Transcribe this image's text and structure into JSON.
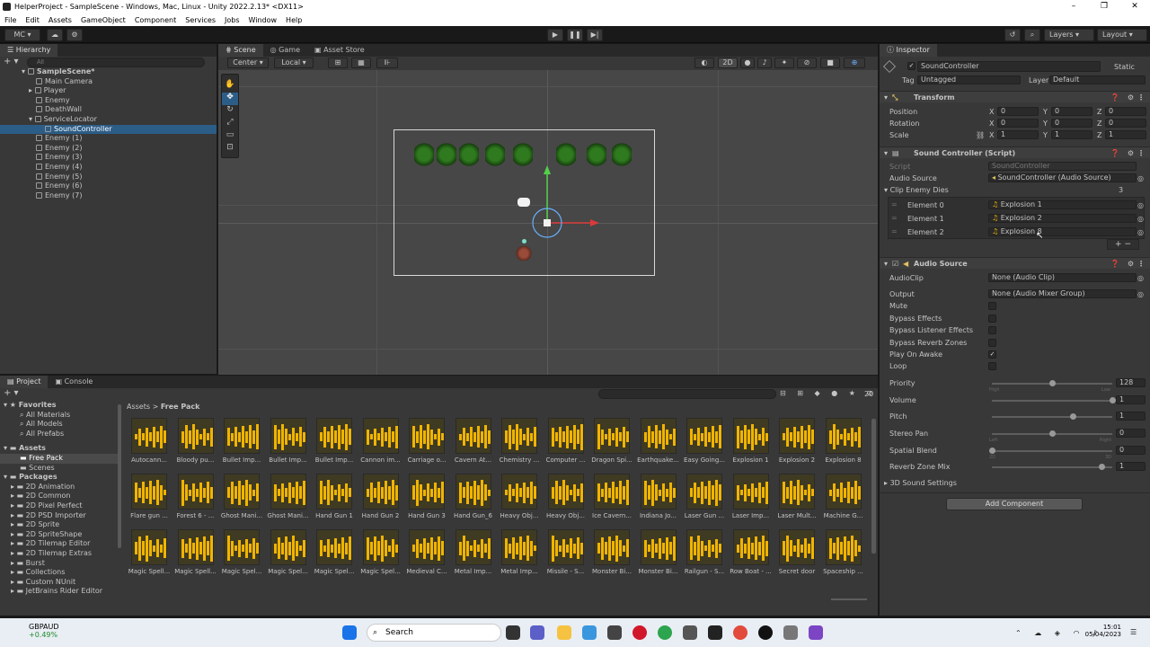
{
  "window": {
    "title": "HelperProject - SampleScene - Windows, Mac, Linux - Unity 2022.2.13* <DX11>"
  },
  "menu": [
    "File",
    "Edit",
    "Assets",
    "GameObject",
    "Component",
    "Services",
    "Jobs",
    "Window",
    "Help"
  ],
  "toolbar": {
    "account": "MC",
    "layers": "Layers",
    "layout": "Layout"
  },
  "hierarchy": {
    "tab": "Hierarchy",
    "search_placeholder": "All",
    "scene": "SampleScene*",
    "items": [
      "Main Camera",
      "Player",
      "Enemy",
      "DeathWall",
      "ServiceLocator",
      "SoundController",
      "Enemy (1)",
      "Enemy (2)",
      "Enemy (3)",
      "Enemy (4)",
      "Enemy (5)",
      "Enemy (6)",
      "Enemy (7)"
    ],
    "selected": "SoundController"
  },
  "scene_tabs": [
    "Scene",
    "Game",
    "Asset Store"
  ],
  "scene_toolbar": {
    "pivot": "Center",
    "space": "Local",
    "mode2d": "2D"
  },
  "inspector": {
    "tab": "Inspector",
    "object_name": "SoundController",
    "static_label": "Static",
    "tag_label": "Tag",
    "tag_value": "Untagged",
    "layer_label": "Layer",
    "layer_value": "Default",
    "transform": {
      "title": "Transform",
      "position_label": "Position",
      "rotation_label": "Rotation",
      "scale_label": "Scale",
      "position": [
        "0",
        "0",
        "0"
      ],
      "rotation": [
        "0",
        "0",
        "0"
      ],
      "scale": [
        "1",
        "1",
        "1"
      ],
      "x": "X",
      "y": "Y",
      "z": "Z"
    },
    "sound_controller": {
      "title": "Sound Controller (Script)",
      "script_label": "Script",
      "script_value": "SoundController",
      "audio_source_label": "Audio Source",
      "audio_source_value": "SoundController (Audio Source)",
      "clip_list_label": "Clip Enemy Dies",
      "clip_count": "3",
      "elements": [
        {
          "label": "Element 0",
          "value": "Explosion 1"
        },
        {
          "label": "Element 1",
          "value": "Explosion 2"
        },
        {
          "label": "Element 2",
          "value": "Explosion 8"
        }
      ],
      "add": "+",
      "remove": "−"
    },
    "audio_source": {
      "title": "Audio Source",
      "audioclip_label": "AudioClip",
      "audioclip_value": "None (Audio Clip)",
      "output_label": "Output",
      "output_value": "None (Audio Mixer Group)",
      "mute": "Mute",
      "bypass_effects": "Bypass Effects",
      "bypass_listener": "Bypass Listener Effects",
      "bypass_reverb": "Bypass Reverb Zones",
      "play_on_awake": "Play On Awake",
      "loop": "Loop",
      "priority_label": "Priority",
      "priority_value": "128",
      "priority_level": 0.5,
      "priority_low": "Low",
      "priority_high": "High",
      "volume_label": "Volume",
      "volume_value": "1",
      "volume_level": 1.0,
      "pitch_label": "Pitch",
      "pitch_value": "1",
      "pitch_level": 0.67,
      "stereo_pan_label": "Stereo Pan",
      "stereo_pan_value": "0",
      "stereo_pan_level": 0.5,
      "pan_left": "Left",
      "pan_right": "Right",
      "spatial_blend_label": "Spatial Blend",
      "spatial_blend_value": "0",
      "spatial_blend_level": 0.0,
      "blend_2d": "2D",
      "blend_3d": "3D",
      "reverb_mix_label": "Reverb Zone Mix",
      "reverb_mix_value": "1",
      "reverb_mix_level": 0.91,
      "sound_settings": "3D Sound Settings"
    },
    "add_component": "Add Component"
  },
  "project": {
    "tabs": [
      "Project",
      "Console"
    ],
    "breadcrumb": [
      "Assets",
      "Free Pack"
    ],
    "badge": "20",
    "favorites_title": "Favorites",
    "favorites": [
      "All Materials",
      "All Models",
      "All Prefabs"
    ],
    "assets_title": "Assets",
    "assets": [
      "Free Pack",
      "Scenes"
    ],
    "packages_title": "Packages",
    "packages": [
      "2D Animation",
      "2D Common",
      "2D Pixel Perfect",
      "2D PSD Importer",
      "2D Sprite",
      "2D SpriteShape",
      "2D Tilemap Editor",
      "2D Tilemap Extras",
      "Burst",
      "Collections",
      "Custom NUnit",
      "JetBrains Rider Editor"
    ],
    "grid": [
      "Autocann...",
      "Bloody pu...",
      "Bullet Imp...",
      "Bullet Imp...",
      "Bullet Imp...",
      "Cannon im...",
      "Carriage o...",
      "Cavern At...",
      "Chemistry ...",
      "Computer ...",
      "Dragon Spi...",
      "Earthquake...",
      "Easy Going...",
      "Explosion 1",
      "Explosion 2",
      "Explosion 8",
      "Flare gun ...",
      "Forest 6 - ...",
      "Ghost Mani...",
      "Ghost Mani...",
      "Hand Gun 1",
      "Hand Gun 2",
      "Hand Gun 3",
      "Hand Gun_6",
      "Heavy Obj...",
      "Heavy Obj...",
      "Ice Cavern...",
      "Indiana Jo...",
      "Laser Gun ...",
      "Laser Imp...",
      "Laser Mult...",
      "Machine G...",
      "Magic Spell...",
      "Magic Spell...",
      "Magic Spel...",
      "Magic Spel...",
      "Magic Spel...",
      "Magic Spel...",
      "Medieval C...",
      "Metal Imp...",
      "Metal Imp...",
      "Missile - S...",
      "Monster Bi...",
      "Monster Bi...",
      "Railgun - S...",
      "Row Boat - ...",
      "Secret door",
      "Spaceship ..."
    ]
  },
  "taskbar": {
    "ticker": "GBPAUD",
    "ticker_change": "+0.49%",
    "search": "Search",
    "time": "15:01",
    "date": "05/04/2023"
  },
  "colors": {
    "accent": "#2c5d87",
    "audio": "#f0b400",
    "gizmo_green": "#52d04a",
    "gizmo_red": "#d83a3a"
  }
}
